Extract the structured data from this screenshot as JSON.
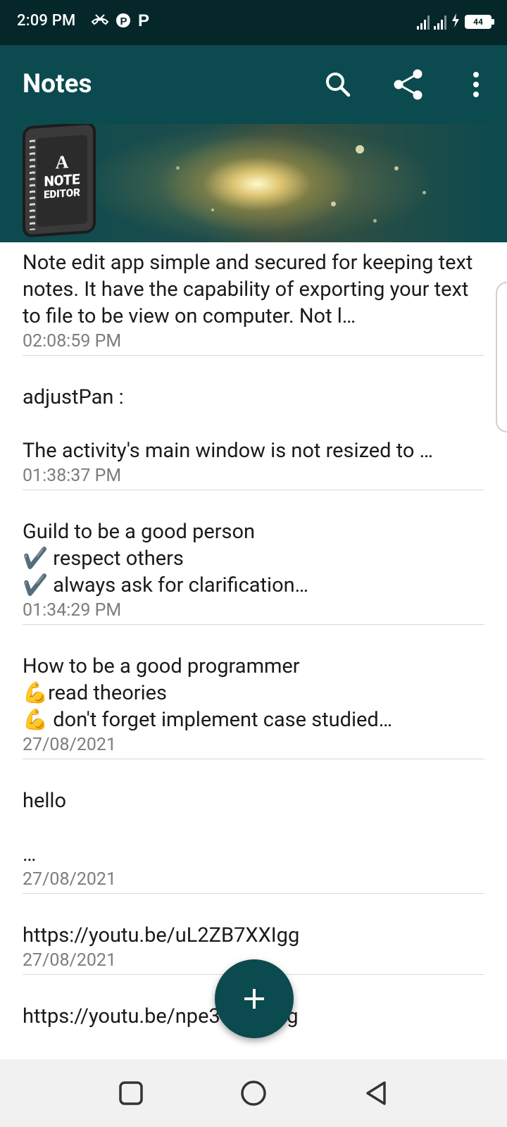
{
  "status_bar": {
    "time": "2:09 PM",
    "battery": "44",
    "icons_left": [
      "missed-call-icon",
      "p-app-icon",
      "p-app-icon"
    ],
    "icons_right": [
      "signal-icon",
      "signal-icon",
      "charging-icon",
      "battery-icon"
    ]
  },
  "app_bar": {
    "title": "Notes",
    "actions": [
      "search-icon",
      "share-icon",
      "more-vert-icon"
    ]
  },
  "banner": {
    "logo_letter": "A",
    "logo_line1": "NOTE",
    "logo_line2": "EDITOR"
  },
  "notes": [
    {
      "body": "Note edit app simple and secured for keeping text notes. It have the capability of exporting your text to file to be view on computer. Not l…",
      "time": "02:08:59 PM"
    },
    {
      "body": "adjustPan :\n\nThe activity's main window is not resized to …",
      "time": "01:38:37 PM"
    },
    {
      "body": "Guild to be a good person\n✔️ respect others\n✔️ always ask for clarification…",
      "time": "01:34:29 PM"
    },
    {
      "body": "How to be a good programmer\n💪read theories\n💪 don't forget implement case studied…",
      "time": "27/08/2021"
    },
    {
      "body": "hello\n\n…",
      "time": "27/08/2021"
    },
    {
      "body": "https://youtu.be/uL2ZB7XXIgg",
      "time": "27/08/2021"
    },
    {
      "body": "https://youtu.be/npe3Wr4tpSg",
      "time": ""
    }
  ],
  "fab": {
    "icon": "plus-icon"
  },
  "nav_bar": {
    "buttons": [
      "recents-square-icon",
      "home-circle-icon",
      "back-triangle-icon"
    ]
  },
  "colors": {
    "primary": "#0b4a4f",
    "status_bar": "#06272a",
    "divider": "#d8d8d8",
    "timestamp": "#7d7d7d"
  }
}
